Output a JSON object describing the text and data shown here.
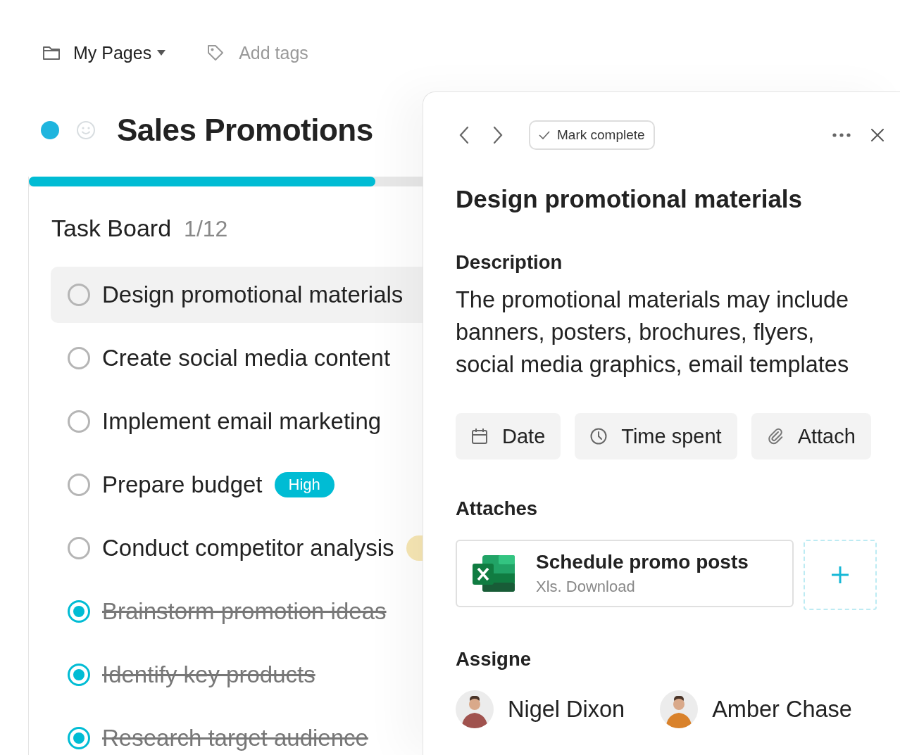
{
  "breadcrumb": {
    "folder": "My Pages",
    "tags_placeholder": "Add tags"
  },
  "project": {
    "title": "Sales Promotions",
    "color": "#1fb5de",
    "progress": {
      "level": 0.88
    }
  },
  "task_board": {
    "title": "Task Board",
    "count": "1/12",
    "tasks": [
      {
        "label": "Design promotional materials",
        "done": false,
        "selected": true
      },
      {
        "label": "Create social media content",
        "done": false,
        "selected": false
      },
      {
        "label": "Implement email marketing",
        "done": false,
        "selected": false
      },
      {
        "label": "Prepare budget",
        "done": false,
        "selected": false,
        "badge": {
          "label": "High",
          "color": "#00bcd4"
        }
      },
      {
        "label": "Conduct competitor analysis",
        "done": false,
        "selected": false,
        "badge": {
          "color": "#f7e7b4"
        }
      },
      {
        "label": "Brainstorm promotion ideas",
        "done": true,
        "selected": false
      },
      {
        "label": "Identify key products",
        "done": true,
        "selected": false
      },
      {
        "label": "Research target audience",
        "done": true,
        "selected": false
      }
    ]
  },
  "detail": {
    "mark_complete": "Mark complete",
    "title": "Design promotional materials",
    "description_heading": "Description",
    "description": "The promotional materials may include banners, posters, brochures, flyers, social media graphics, email templates",
    "actions": [
      {
        "kind": "date",
        "label": "Date"
      },
      {
        "kind": "time",
        "label": "Time spent"
      },
      {
        "kind": "attach",
        "label": "Attach"
      }
    ],
    "attaches_heading": "Attaches",
    "attachments": [
      {
        "name": "Schedule promo posts",
        "meta": "Xls. Download"
      }
    ],
    "assignee_heading": "Assigne",
    "assignees": [
      {
        "name": "Nigel Dixon"
      },
      {
        "name": "Amber Chase"
      }
    ]
  }
}
